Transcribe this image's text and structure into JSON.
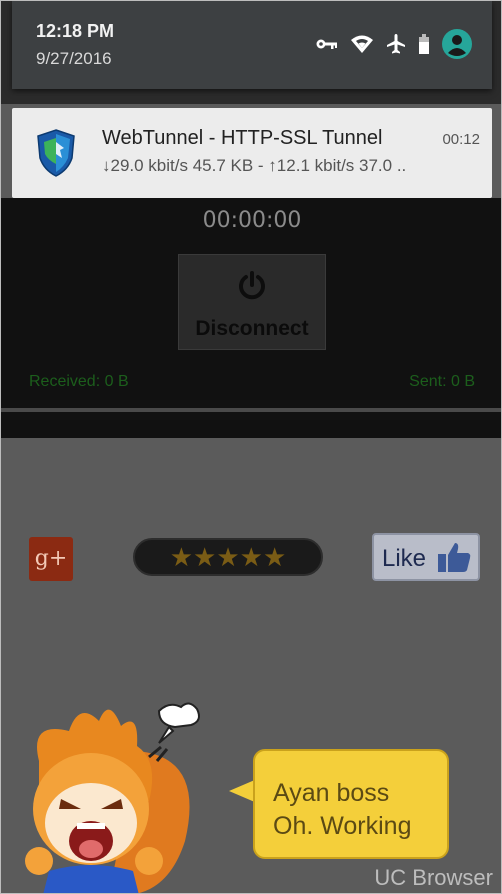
{
  "status_bar": {
    "time": "12:18 PM",
    "date": "9/27/2016",
    "icons": [
      "vpn-key-icon",
      "wifi-icon",
      "airplane-mode-icon",
      "battery-icon",
      "account-icon"
    ]
  },
  "notification": {
    "title": "WebTunnel -  HTTP-SSL Tunnel",
    "time": "00:12",
    "body": "↓29.0 kbit/s 45.7 KB - ↑12.1 kbit/s 37.0 ..",
    "icon": "shield-app-icon"
  },
  "app": {
    "timer": "00:00:00",
    "disconnect_label": "Disconnect",
    "received": "Received: 0 B",
    "sent": "Sent: 0 B"
  },
  "social": {
    "gplus": "g+",
    "rating_stars": 5,
    "stars_text": "★★★★★",
    "like_label": "Like"
  },
  "bubble": {
    "line1": "Ayan boss",
    "line2": "Oh.  Working"
  },
  "watermark": "UC Browser",
  "colors": {
    "accent": "#26a69a",
    "stat_green": "#1c5e1c",
    "bubble": "#f4cf3a"
  }
}
